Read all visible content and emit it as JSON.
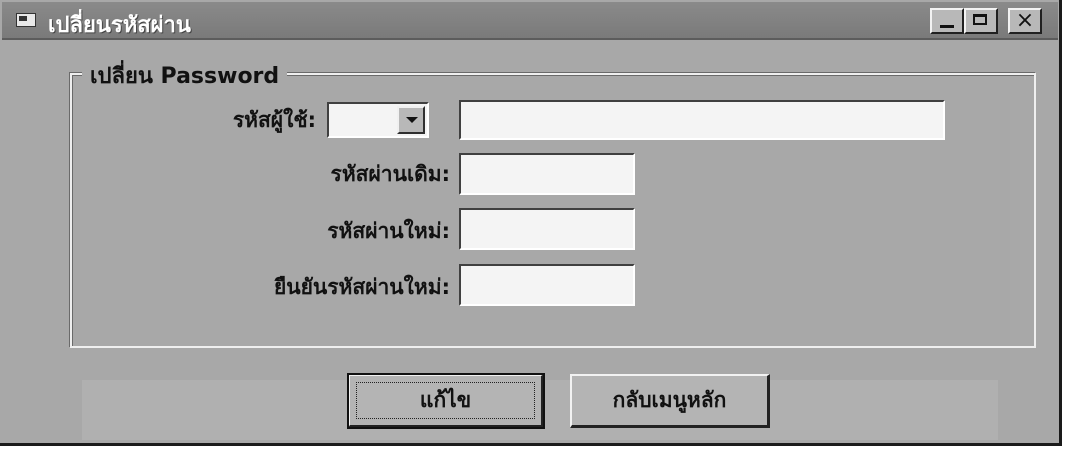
{
  "window": {
    "title": "เปลี่ยนรหัสผ่าน",
    "controls": {
      "close_glyph": "×"
    }
  },
  "form": {
    "group_title": "เปลี่ยน Password",
    "user_id_label": "รหัสผู้ใช้:",
    "user_id_value": "",
    "user_name_value": "",
    "old_password_label": "รหัสผ่านเดิม:",
    "old_password_value": "",
    "new_password_label": "รหัสผ่านใหม่:",
    "new_password_value": "",
    "confirm_password_label": "ยืนยันรหัสผ่านใหม่:",
    "confirm_password_value": ""
  },
  "buttons": {
    "save_label": "แก้ไข",
    "back_label": "กลับเมนูหลัก"
  },
  "icons": [
    "window-app-icon",
    "minimize-icon",
    "maximize-icon",
    "close-icon",
    "dropdown-arrow-icon"
  ]
}
